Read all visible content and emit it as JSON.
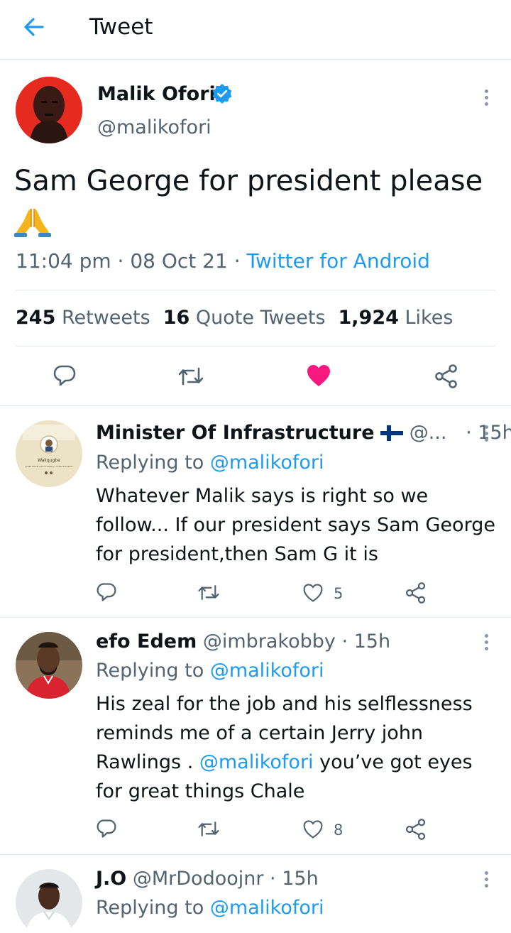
{
  "header": {
    "title": "Tweet"
  },
  "tweet": {
    "author": {
      "name": "Malik Ofori",
      "handle": "@malikofori"
    },
    "text": "Sam George for president please",
    "time": "11:04 pm",
    "date": "08 Oct 21",
    "source": "Twitter for Android",
    "stats": {
      "retweets_count": "245",
      "retweets_label": "Retweets",
      "quotes_count": "16",
      "quotes_label": "Quote Tweets",
      "likes_count": "1,924",
      "likes_label": "Likes"
    },
    "liked": true,
    "icons": [
      "back-arrow-icon",
      "verified-badge-icon",
      "more-icon",
      "reply-icon",
      "retweet-icon",
      "heart-icon",
      "share-icon",
      "praying-hands-emoji"
    ]
  },
  "replies": [
    {
      "name": "Minister Of Infrastructure",
      "handle": "@...",
      "time": "15h",
      "replying_label": "Replying to",
      "replying_to": "@malikofori",
      "text": "Whatever Malik says is right so we follow... If our president says Sam George for president,then Sam G it is",
      "likes": "5",
      "avatar_text": {
        "title": "Wakqugbe",
        "line": "(whitt hhsslt ivodu bdtsitto) ·rhdidi lfnhirblHt·"
      }
    },
    {
      "name": "efo Edem",
      "handle": "@imbrakobby",
      "time": "15h",
      "replying_label": "Replying to",
      "replying_to": "@malikofori",
      "text_before": "His zeal for the job and his selflessness reminds me of a certain Jerry john Rawlings .",
      "text_mention": "@malikofori",
      "text_after": "you’ve got eyes for great things Chale",
      "likes": "8"
    },
    {
      "name": "J.O",
      "handle": "@MrDodoojnr",
      "time": "15h",
      "replying_label": "Replying to",
      "replying_to": "@malikofori"
    }
  ],
  "colors": {
    "accent": "#1d9bf0",
    "like": "#f91880",
    "secondary_text": "#536471",
    "divider": "#e1e8ed"
  }
}
